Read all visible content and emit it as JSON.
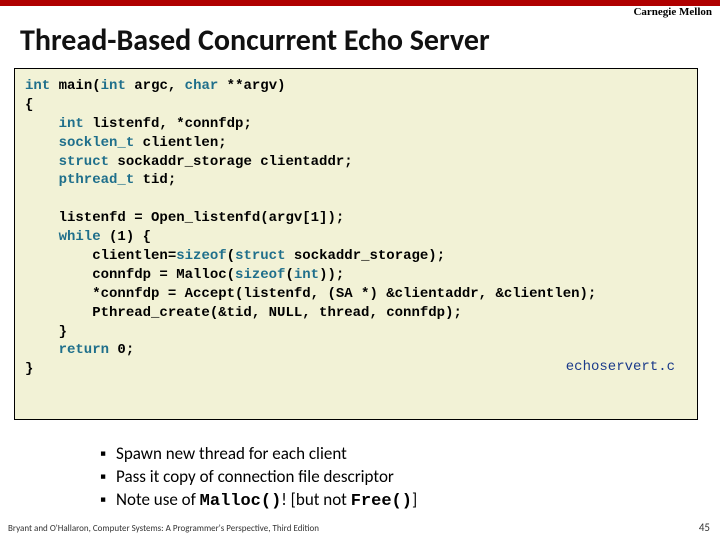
{
  "header": {
    "org": "Carnegie Mellon",
    "title": "Thread-Based Concurrent Echo Server"
  },
  "code": {
    "l1a": "int",
    "l1b": " main(",
    "l1c": "int",
    "l1d": " argc, ",
    "l1e": "char",
    "l1f": " **argv)",
    "l2": "{",
    "l3a": "    int",
    "l3b": " listenfd, *connfdp;",
    "l4a": "    socklen_t",
    "l4b": " clientlen;",
    "l5a": "    struct",
    "l5b": " sockaddr_storage clientaddr;",
    "l6a": "    pthread_t",
    "l6b": " tid;",
    "blank1": "",
    "l8": "    listenfd = Open_listenfd(argv[1]);",
    "l9a": "    while",
    "l9b": " (1) {",
    "l10a": "        clientlen=",
    "l10b": "sizeof",
    "l10c": "(",
    "l10d": "struct",
    "l10e": " sockaddr_storage);",
    "l11a": "        connfdp = Malloc(",
    "l11b": "sizeof",
    "l11c": "(",
    "l11d": "int",
    "l11e": "));",
    "l12": "        *connfdp = Accept(listenfd, (SA *) &clientaddr, &clientlen);",
    "l13": "        Pthread_create(&tid, NULL, thread, connfdp);",
    "l14": "    }",
    "l15a": "    return",
    "l15b": " 0;",
    "l16": "}",
    "file": "echoservert.c"
  },
  "bullets": {
    "b1": "Spawn new thread for each client",
    "b2": "Pass it copy of connection file descriptor",
    "b3a": "Note use of ",
    "b3b": "Malloc()",
    "b3c": "! [but not ",
    "b3d": "Free()",
    "b3e": "]"
  },
  "footer": {
    "text": "Bryant and O'Hallaron, Computer Systems: A Programmer's Perspective, Third Edition",
    "page": "45"
  }
}
